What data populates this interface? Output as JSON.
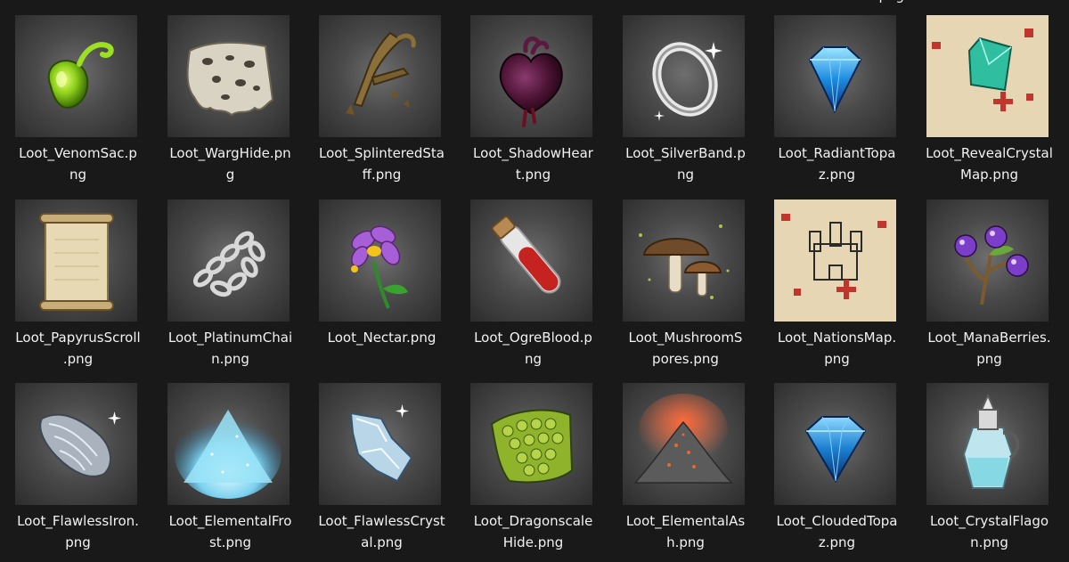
{
  "partial_caption_top": "png",
  "files": [
    {
      "name": "Loot_VenomSac.png",
      "line1": "Loot_VenomSac.p",
      "line2": "ng",
      "icon": "venom-sac-icon"
    },
    {
      "name": "Loot_WargHide.png",
      "line1": "Loot_WargHide.pn",
      "line2": "g",
      "icon": "warg-hide-icon"
    },
    {
      "name": "Loot_SplinteredStaff.png",
      "line1": "Loot_SplinteredSta",
      "line2": "ff.png",
      "icon": "splintered-staff-icon"
    },
    {
      "name": "Loot_ShadowHeart.png",
      "line1": "Loot_ShadowHear",
      "line2": "t.png",
      "icon": "shadow-heart-icon"
    },
    {
      "name": "Loot_SilverBand.png",
      "line1": "Loot_SilverBand.p",
      "line2": "ng",
      "icon": "silver-band-icon"
    },
    {
      "name": "Loot_RadiantTopaz.png",
      "line1": "Loot_RadiantTopa",
      "line2": "z.png",
      "icon": "radiant-topaz-icon"
    },
    {
      "name": "Loot_RevealCrystalMap.png",
      "line1": "Loot_RevealCrystal",
      "line2": "Map.png",
      "icon": "reveal-crystal-map-icon"
    },
    {
      "name": "Loot_PapyrusScroll.png",
      "line1": "Loot_PapyrusScroll",
      "line2": ".png",
      "icon": "papyrus-scroll-icon"
    },
    {
      "name": "Loot_PlatinumChain.png",
      "line1": "Loot_PlatinumChai",
      "line2": "n.png",
      "icon": "platinum-chain-icon"
    },
    {
      "name": "Loot_Nectar.png",
      "line1": "Loot_Nectar.png",
      "line2": "",
      "icon": "nectar-icon"
    },
    {
      "name": "Loot_OgreBlood.png",
      "line1": "Loot_OgreBlood.p",
      "line2": "ng",
      "icon": "ogre-blood-icon"
    },
    {
      "name": "Loot_MushroomSpores.png",
      "line1": "Loot_MushroomS",
      "line2": "pores.png",
      "icon": "mushroom-spores-icon"
    },
    {
      "name": "Loot_NationsMap.png",
      "line1": "Loot_NationsMap.",
      "line2": "png",
      "icon": "nations-map-icon"
    },
    {
      "name": "Loot_ManaBerries.png",
      "line1": "Loot_ManaBerries.",
      "line2": "png",
      "icon": "mana-berries-icon"
    },
    {
      "name": "Loot_FlawlessIron.png",
      "line1": "Loot_FlawlessIron.",
      "line2": "png",
      "icon": "flawless-iron-icon"
    },
    {
      "name": "Loot_ElementalFrost.png",
      "line1": "Loot_ElementalFro",
      "line2": "st.png",
      "icon": "elemental-frost-icon"
    },
    {
      "name": "Loot_FlawlessCrystal.png",
      "line1": "Loot_FlawlessCryst",
      "line2": "al.png",
      "icon": "flawless-crystal-icon"
    },
    {
      "name": "Loot_DragonscaleHide.png",
      "line1": "Loot_Dragonscale",
      "line2": "Hide.png",
      "icon": "dragonscale-hide-icon"
    },
    {
      "name": "Loot_ElementalAsh.png",
      "line1": "Loot_ElementalAs",
      "line2": "h.png",
      "icon": "elemental-ash-icon"
    },
    {
      "name": "Loot_CloudedTopaz.png",
      "line1": "Loot_CloudedTopa",
      "line2": "z.png",
      "icon": "clouded-topaz-icon"
    },
    {
      "name": "Loot_CrystalFlagon.png",
      "line1": "Loot_CrystalFlago",
      "line2": "n.png",
      "icon": "crystal-flagon-icon"
    }
  ]
}
